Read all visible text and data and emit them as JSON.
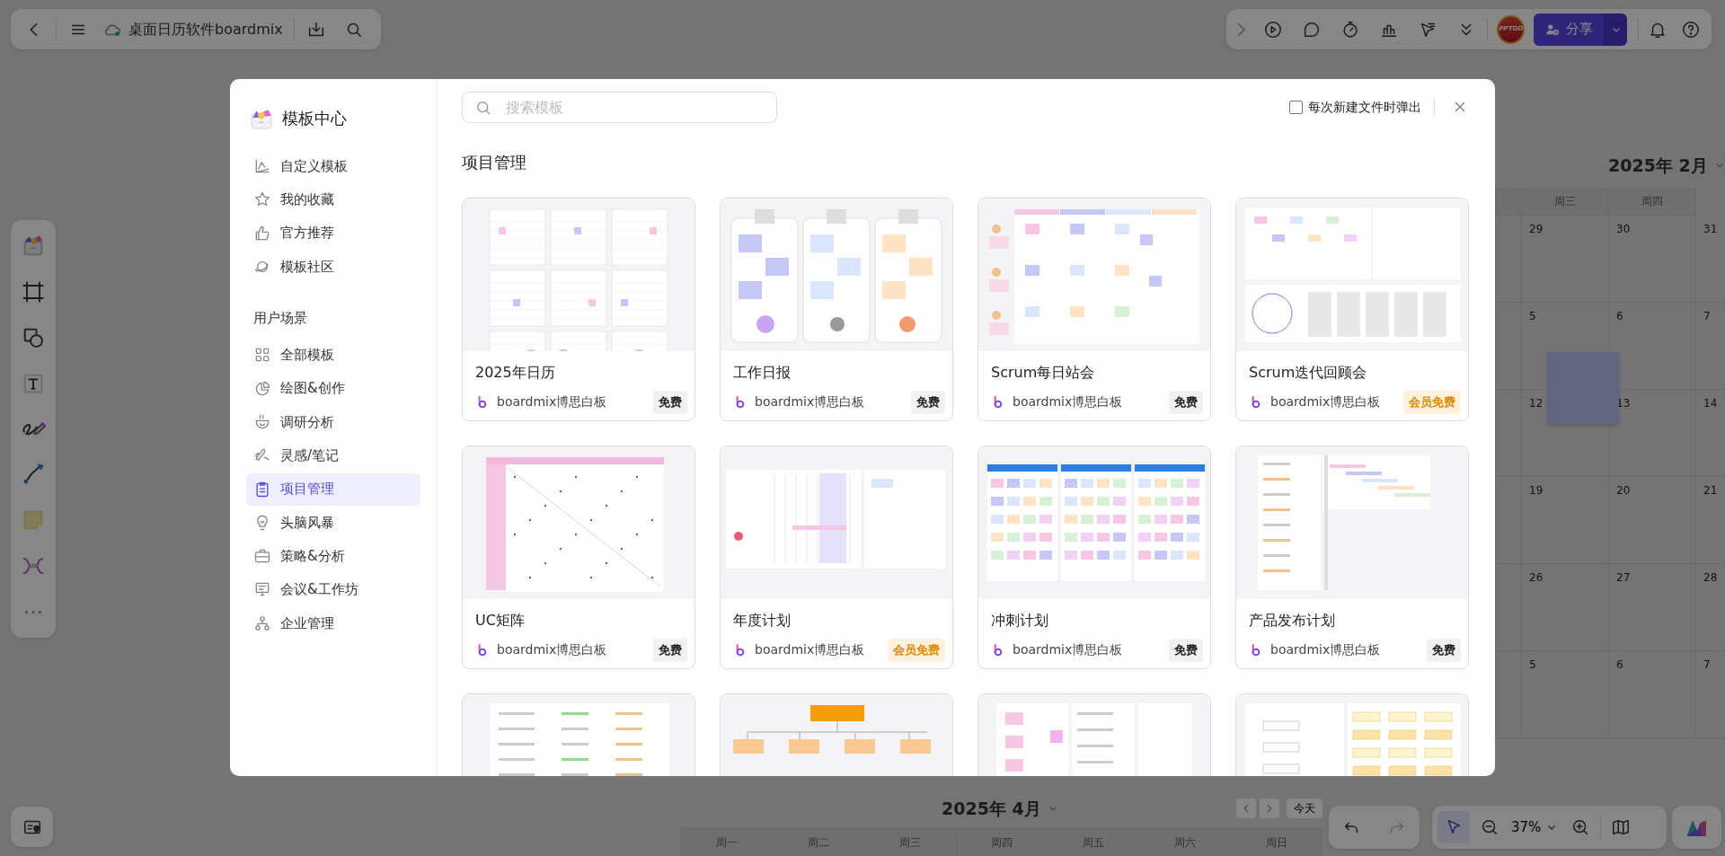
{
  "header": {
    "file_name": "桌面日历软件boardmix",
    "synced": true
  },
  "collab": {
    "avatar_label": "PPTGO",
    "share_label": "分享"
  },
  "template_center": {
    "title": "模板中心",
    "nav": [
      {
        "label": "自定义模板",
        "selected": false
      },
      {
        "label": "我的收藏",
        "selected": false
      },
      {
        "label": "官方推荐",
        "selected": false
      },
      {
        "label": "模板社区",
        "selected": false
      }
    ],
    "scene_heading": "用户场景",
    "scenes": [
      {
        "label": "全部模板",
        "selected": false
      },
      {
        "label": "绘图&创作",
        "selected": false
      },
      {
        "label": "调研分析",
        "selected": false
      },
      {
        "label": "灵感/笔记",
        "selected": false
      },
      {
        "label": "项目管理",
        "selected": true
      },
      {
        "label": "头脑风暴",
        "selected": false
      },
      {
        "label": "策略&分析",
        "selected": false
      },
      {
        "label": "会议&工作坊",
        "selected": false
      },
      {
        "label": "企业管理",
        "selected": false
      }
    ],
    "search": {
      "placeholder": "搜索模板"
    },
    "popup_option": {
      "label": "每次新建文件时弹出",
      "checked": false
    },
    "category_title": "项目管理",
    "templates": [
      {
        "kind": "calendar",
        "title": "2025年日历",
        "author": "boardmix博思白板",
        "badge": {
          "label": "免费",
          "kind": "free"
        }
      },
      {
        "kind": "daily_report",
        "title": "工作日报",
        "author": "boardmix博思白板",
        "badge": {
          "label": "免费",
          "kind": "free"
        }
      },
      {
        "kind": "standup",
        "title": "Scrum每日站会",
        "author": "boardmix博思白板",
        "badge": {
          "label": "免费",
          "kind": "free"
        }
      },
      {
        "kind": "retro",
        "title": "Scrum迭代回顾会",
        "author": "boardmix博思白板",
        "badge": {
          "label": "会员免费",
          "kind": "member"
        }
      },
      {
        "kind": "matrix",
        "title": "UC矩阵",
        "author": "boardmix博思白板",
        "badge": {
          "label": "免费",
          "kind": "free"
        }
      },
      {
        "kind": "timeline",
        "title": "年度计划",
        "author": "boardmix博思白板",
        "badge": {
          "label": "会员免费",
          "kind": "member"
        }
      },
      {
        "kind": "sprint",
        "title": "冲刺计划",
        "author": "boardmix博思白板",
        "badge": {
          "label": "免费",
          "kind": "free"
        }
      },
      {
        "kind": "release",
        "title": "产品发布计划",
        "author": "boardmix博思白板",
        "badge": {
          "label": "免费",
          "kind": "free"
        }
      }
    ],
    "more_templates": [
      {
        "kind": "checklist"
      },
      {
        "kind": "org_chart"
      },
      {
        "kind": "kanban"
      },
      {
        "kind": "flow"
      }
    ]
  },
  "canvas": {
    "february": {
      "title": "2025年 2月",
      "weekdays": [
        "周三",
        "周四"
      ],
      "rows": [
        [
          "29",
          "30",
          "31"
        ],
        [
          "5",
          "6",
          "7"
        ],
        [
          "12",
          "13",
          "14"
        ],
        [
          "19",
          "20",
          "21"
        ],
        [
          "26",
          "27",
          "28"
        ],
        [
          "5",
          "6",
          "7"
        ]
      ]
    },
    "april": {
      "title": "2025年 4月",
      "today": "今天",
      "weekdays": [
        "周一",
        "周二",
        "周三",
        "周四",
        "周五",
        "周六",
        "周日"
      ]
    }
  },
  "zoom": {
    "label": "37%"
  }
}
